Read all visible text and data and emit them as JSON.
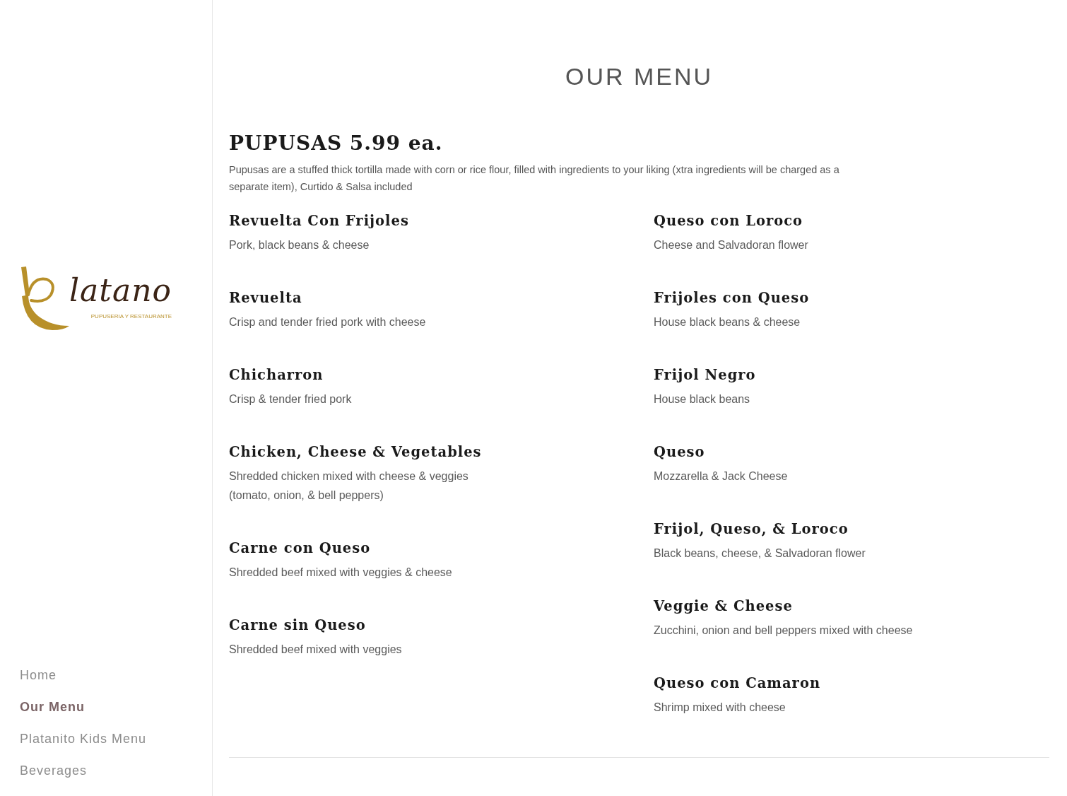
{
  "sidebar": {
    "logo": {
      "wordmark": "latano",
      "tagline": "PUPUSERIA Y RESTAURANTE"
    },
    "nav": [
      {
        "label": "Home",
        "selected": false
      },
      {
        "label": "Our Menu",
        "selected": true
      },
      {
        "label": "Platanito Kids Menu",
        "selected": false
      },
      {
        "label": "Beverages",
        "selected": false
      }
    ]
  },
  "page": {
    "title": "OUR MENU",
    "section": {
      "heading": "PUPUSAS 5.99 ea.",
      "description": "Pupusas are a stuffed thick tortilla made with corn or rice flour, filled with ingredients to your liking (xtra ingredients will be charged as a separate item), Curtido & Salsa included",
      "columns": [
        [
          {
            "name": "Revuelta Con Frijoles",
            "description": "Pork, black beans & cheese"
          },
          {
            "name": "Revuelta",
            "description": "Crisp and tender fried pork with cheese"
          },
          {
            "name": "Chicharron",
            "description": "Crisp & tender fried pork"
          },
          {
            "name": "Chicken, Cheese & Vegetables",
            "description": "Shredded chicken mixed with cheese & veggies\n(tomato, onion, & bell peppers)"
          },
          {
            "name": "Carne con Queso",
            "description": "Shredded beef mixed with veggies & cheese"
          },
          {
            "name": "Carne sin Queso",
            "description": "Shredded beef mixed with veggies"
          }
        ],
        [
          {
            "name": "Queso con Loroco",
            "description": "Cheese and Salvadoran flower"
          },
          {
            "name": "Frijoles con Queso",
            "description": "House black beans & cheese"
          },
          {
            "name": "Frijol Negro",
            "description": "House black beans"
          },
          {
            "name": "Queso",
            "description": "Mozzarella & Jack Cheese"
          },
          {
            "name": "Frijol, Queso, & Loroco",
            "description": "Black beans, cheese, & Salvadoran flower"
          },
          {
            "name": "Veggie & Cheese",
            "description": "Zucchini, onion and bell peppers mixed with cheese"
          },
          {
            "name": "Queso con Camaron",
            "description": "Shrimp mixed with cheese"
          }
        ]
      ]
    }
  }
}
